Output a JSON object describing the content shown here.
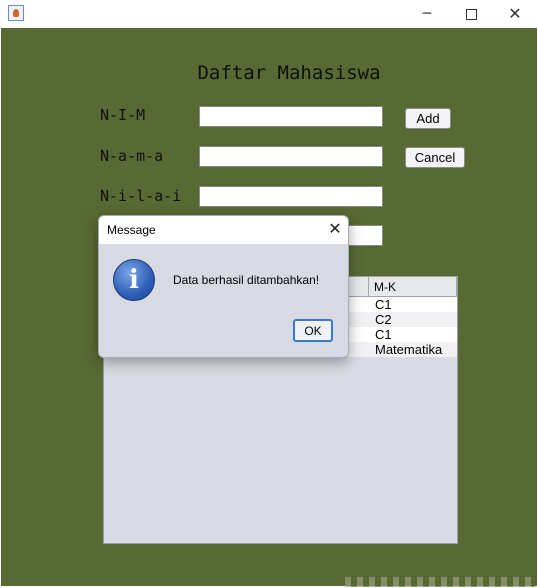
{
  "window": {
    "title": ""
  },
  "form": {
    "heading": "Daftar Mahasiswa",
    "labels": {
      "nim": "N-I-M",
      "nama": "N-a-m-a",
      "nilai": "N-i-l-a-i"
    },
    "fields": {
      "nim": "",
      "nama": "",
      "nilai": "",
      "mk": ""
    },
    "buttons": {
      "add": "Add",
      "cancel": "Cancel"
    }
  },
  "table": {
    "visible_header": "M-K",
    "rows": [
      "C1",
      "C2",
      "C1",
      "Matematika"
    ]
  },
  "dialog": {
    "title": "Message",
    "message": "Data berhasil ditambahkan!",
    "ok_label": "OK",
    "icon": "info-icon"
  },
  "colors": {
    "frame_background": "#586a33",
    "dialog_background": "#d7dae3",
    "table_background": "#d8dbe3",
    "ok_border": "#3b79c9"
  },
  "icons": {
    "window_minimize": "─",
    "window_close": "✕",
    "dialog_close": "✕",
    "info_glyph": "i"
  }
}
